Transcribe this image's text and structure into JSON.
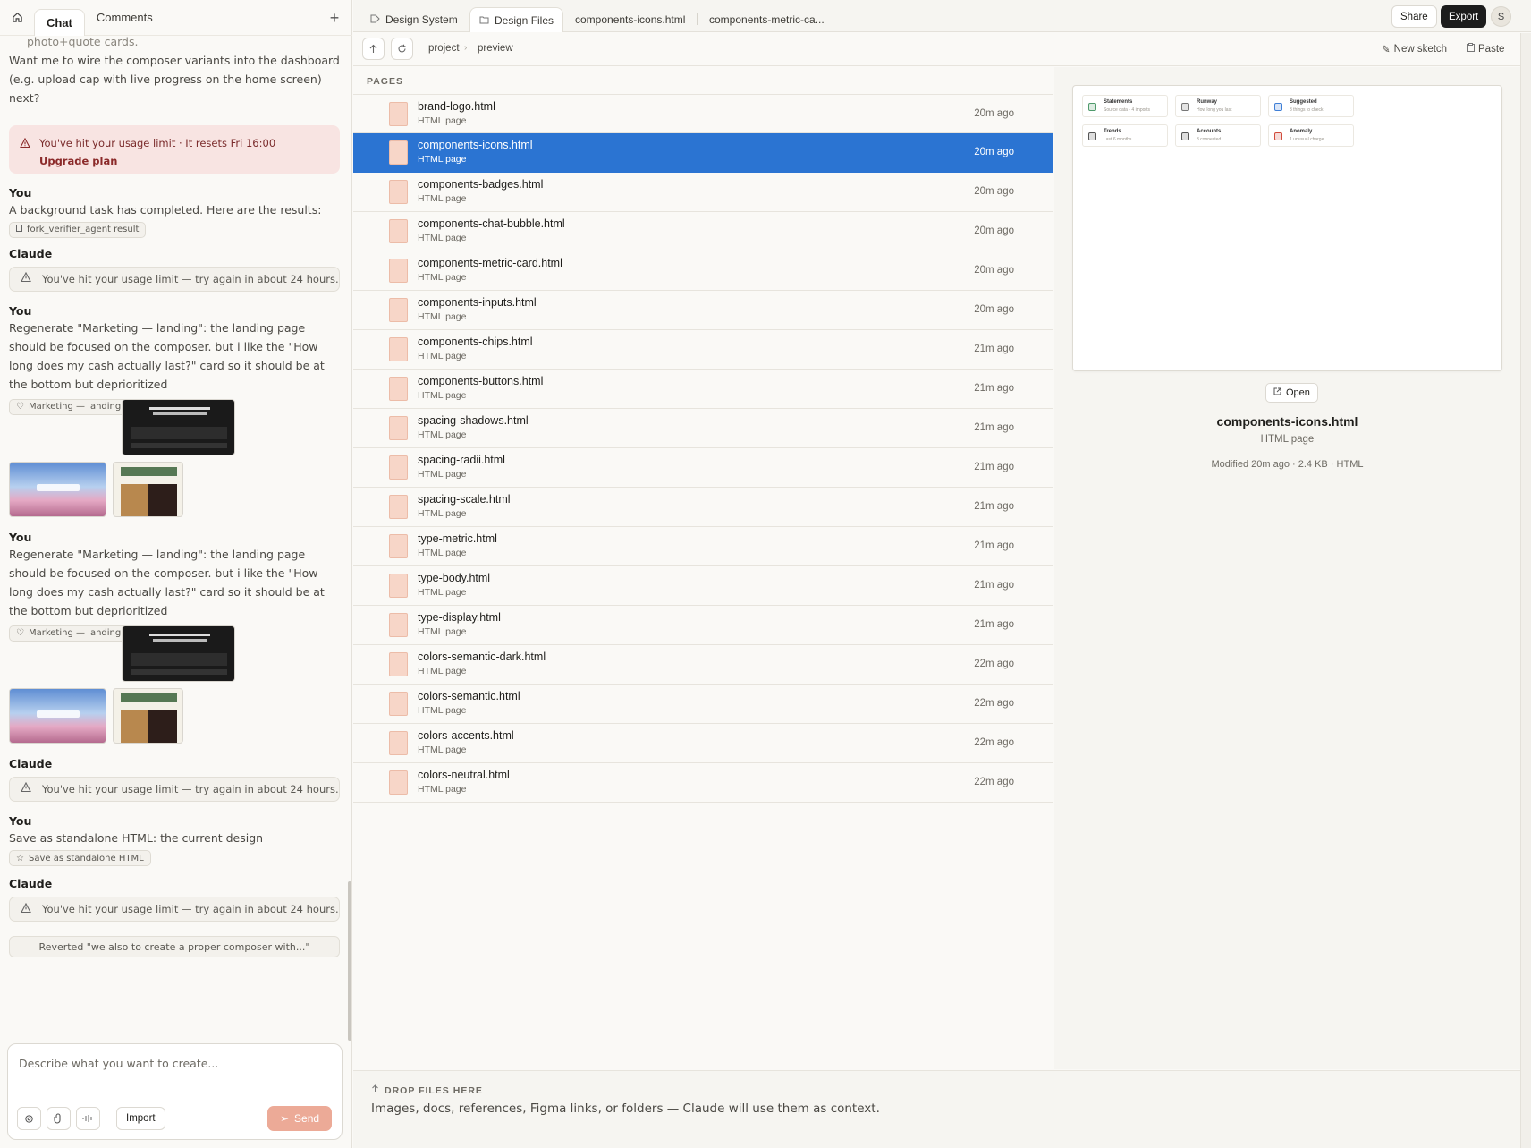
{
  "left_tabs": {
    "chat": "Chat",
    "comments": "Comments"
  },
  "chat": {
    "intro_tail": "photo+quote cards.",
    "intro_question": "Want me to wire the composer variants into the dashboard (e.g. upload cap with live progress on the home screen) next?",
    "usage_banner": "You've hit your usage limit · It resets Fri 16:00",
    "upgrade": "Upgrade plan",
    "msg1_who": "You",
    "msg1_text": "A background task has completed. Here are the results:",
    "msg1_pill": "fork_verifier_agent result",
    "msg2_who": "Claude",
    "limit_text": "You've hit your usage limit — try again in about 24 hours.",
    "msg3_who": "You",
    "regen_text": "Regenerate \"Marketing — landing\": the landing page should be focused on the composer. but i like the \"How long does my cash actually last?\" card so it should be at the bottom but deprioritized",
    "marketing_pill": "Marketing — landing",
    "msg4_who": "You",
    "msg5_who": "Claude",
    "msg6_who": "You",
    "save_text": "Save as standalone HTML: the current design",
    "save_pill": "Save as standalone HTML",
    "msg7_who": "Claude",
    "reverted": "Reverted \"we also to create a proper composer with...\""
  },
  "composer": {
    "placeholder": "Describe what you want to create...",
    "import": "Import",
    "send": "Send"
  },
  "topbar": {
    "tabs": [
      "Design System",
      "Design Files",
      "components-icons.html",
      "components-metric-ca..."
    ],
    "share": "Share",
    "export": "Export",
    "avatar": "S"
  },
  "pathbar": {
    "crumbs": [
      "project",
      "preview"
    ],
    "new_sketch": "New sketch",
    "paste": "Paste"
  },
  "pages_heading": "PAGES",
  "files": [
    {
      "name": "brand-logo.html",
      "type": "HTML page",
      "time": "20m ago"
    },
    {
      "name": "components-icons.html",
      "type": "HTML page",
      "time": "20m ago"
    },
    {
      "name": "components-badges.html",
      "type": "HTML page",
      "time": "20m ago"
    },
    {
      "name": "components-chat-bubble.html",
      "type": "HTML page",
      "time": "20m ago"
    },
    {
      "name": "components-metric-card.html",
      "type": "HTML page",
      "time": "20m ago"
    },
    {
      "name": "components-inputs.html",
      "type": "HTML page",
      "time": "20m ago"
    },
    {
      "name": "components-chips.html",
      "type": "HTML page",
      "time": "21m ago"
    },
    {
      "name": "components-buttons.html",
      "type": "HTML page",
      "time": "21m ago"
    },
    {
      "name": "spacing-shadows.html",
      "type": "HTML page",
      "time": "21m ago"
    },
    {
      "name": "spacing-radii.html",
      "type": "HTML page",
      "time": "21m ago"
    },
    {
      "name": "spacing-scale.html",
      "type": "HTML page",
      "time": "21m ago"
    },
    {
      "name": "type-metric.html",
      "type": "HTML page",
      "time": "21m ago"
    },
    {
      "name": "type-body.html",
      "type": "HTML page",
      "time": "21m ago"
    },
    {
      "name": "type-display.html",
      "type": "HTML page",
      "time": "21m ago"
    },
    {
      "name": "colors-semantic-dark.html",
      "type": "HTML page",
      "time": "22m ago"
    },
    {
      "name": "colors-semantic.html",
      "type": "HTML page",
      "time": "22m ago"
    },
    {
      "name": "colors-accents.html",
      "type": "HTML page",
      "time": "22m ago"
    },
    {
      "name": "colors-neutral.html",
      "type": "HTML page",
      "time": "22m ago"
    }
  ],
  "selected_file_index": 1,
  "preview": {
    "cards": [
      {
        "title": "Statements",
        "sub": "Source data · 4 imports",
        "icon_color": "#4f9a6b"
      },
      {
        "title": "Runway",
        "sub": "How long you last",
        "icon_color": "#777777"
      },
      {
        "title": "Suggested",
        "sub": "3 things to check",
        "icon_color": "#3f7fd6"
      },
      {
        "title": "Trends",
        "sub": "Last 6 months",
        "icon_color": "#555555"
      },
      {
        "title": "Accounts",
        "sub": "3 connected",
        "icon_color": "#555555"
      },
      {
        "title": "Anomaly",
        "sub": "1 unusual charge",
        "icon_color": "#d14b3b"
      }
    ],
    "open": "Open",
    "name": "components-icons.html",
    "type": "HTML page",
    "meta": "Modified 20m ago · 2.4 KB · HTML"
  },
  "drop": {
    "heading": "DROP FILES HERE",
    "text": "Images, docs, references, Figma links, or folders — Claude will use them as context."
  },
  "colors": {
    "selection": "#2b74d2",
    "warning_bg": "#f8e4e2",
    "send": "#ecaa97",
    "export": "#1c1c1c"
  }
}
